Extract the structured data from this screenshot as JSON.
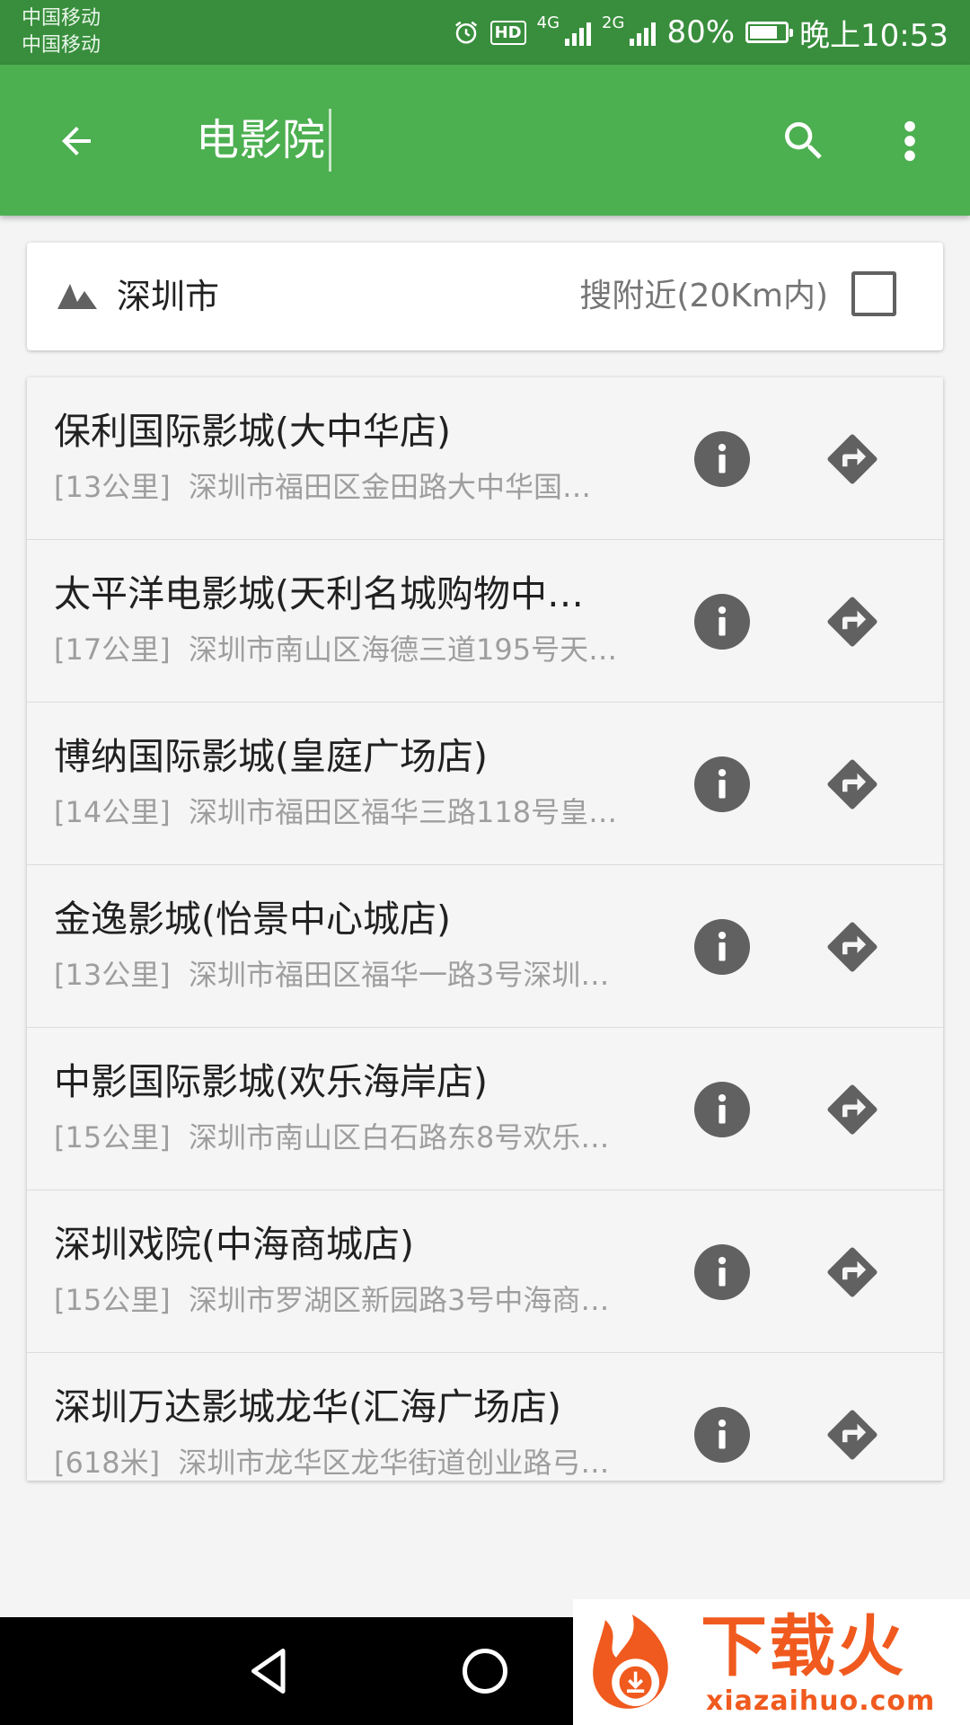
{
  "status_bar": {
    "carrier_1": "中国移动",
    "carrier_2": "中国移动",
    "network_1": "4G",
    "network_2": "2G",
    "hd_label": "HD",
    "battery": "80%",
    "battery_level": 0.8,
    "time": "晚上10:53"
  },
  "toolbar": {
    "query": "电影院",
    "back_icon": "arrow-left-icon",
    "search_icon": "search-icon",
    "more_icon": "more-vert-icon",
    "color": "#4caf50"
  },
  "city_filter": {
    "city": "深圳市",
    "nearby_label": "搜附近(20Km内)",
    "nearby_checked": false
  },
  "results": [
    {
      "title": "保利国际影城(大中华店)",
      "distance": "[13公里]",
      "address": "深圳市福田区金田路大中华国…"
    },
    {
      "title": "太平洋电影城(天利名城购物中…",
      "distance": "[17公里]",
      "address": "深圳市南山区海德三道195号天…"
    },
    {
      "title": "博纳国际影城(皇庭广场店)",
      "distance": "[14公里]",
      "address": "深圳市福田区福华三路118号皇…"
    },
    {
      "title": "金逸影城(怡景中心城店)",
      "distance": "[13公里]",
      "address": "深圳市福田区福华一路3号深圳…"
    },
    {
      "title": "中影国际影城(欢乐海岸店)",
      "distance": "[15公里]",
      "address": "深圳市南山区白石路东8号欢乐…"
    },
    {
      "title": "深圳戏院(中海商城店)",
      "distance": "[15公里]",
      "address": "深圳市罗湖区新园路3号中海商…"
    },
    {
      "title": "深圳万达影城龙华(汇海广场店)",
      "distance": "[618米]",
      "address": "深圳市龙华区龙华街道创业路弓…"
    }
  ],
  "watermark": {
    "brand": "下载火",
    "url": "xiazaihuo.com"
  }
}
